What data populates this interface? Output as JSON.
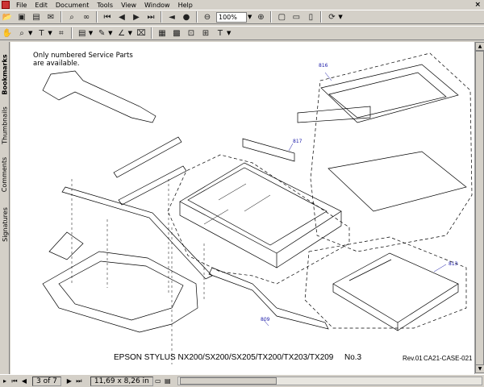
{
  "menu": [
    "File",
    "Edit",
    "Document",
    "Tools",
    "View",
    "Window",
    "Help"
  ],
  "toolbar": {
    "zoom_value": "100%"
  },
  "sidetabs": [
    "Bookmarks",
    "Thumbnails",
    "Comments",
    "Signatures"
  ],
  "document": {
    "note": "Only numbered Service Parts are available.",
    "callouts": [
      "816",
      "817",
      "813",
      "809"
    ],
    "footer_title": "EPSON STYLUS NX200/SX200/SX205/TX200/TX203/TX209",
    "footer_no": "No.3",
    "footer_rev": "Rev.01",
    "footer_code": "CA21-CASE-021"
  },
  "status": {
    "page": "3 of 7",
    "dimensions": "11,69 x 8,26 in"
  }
}
